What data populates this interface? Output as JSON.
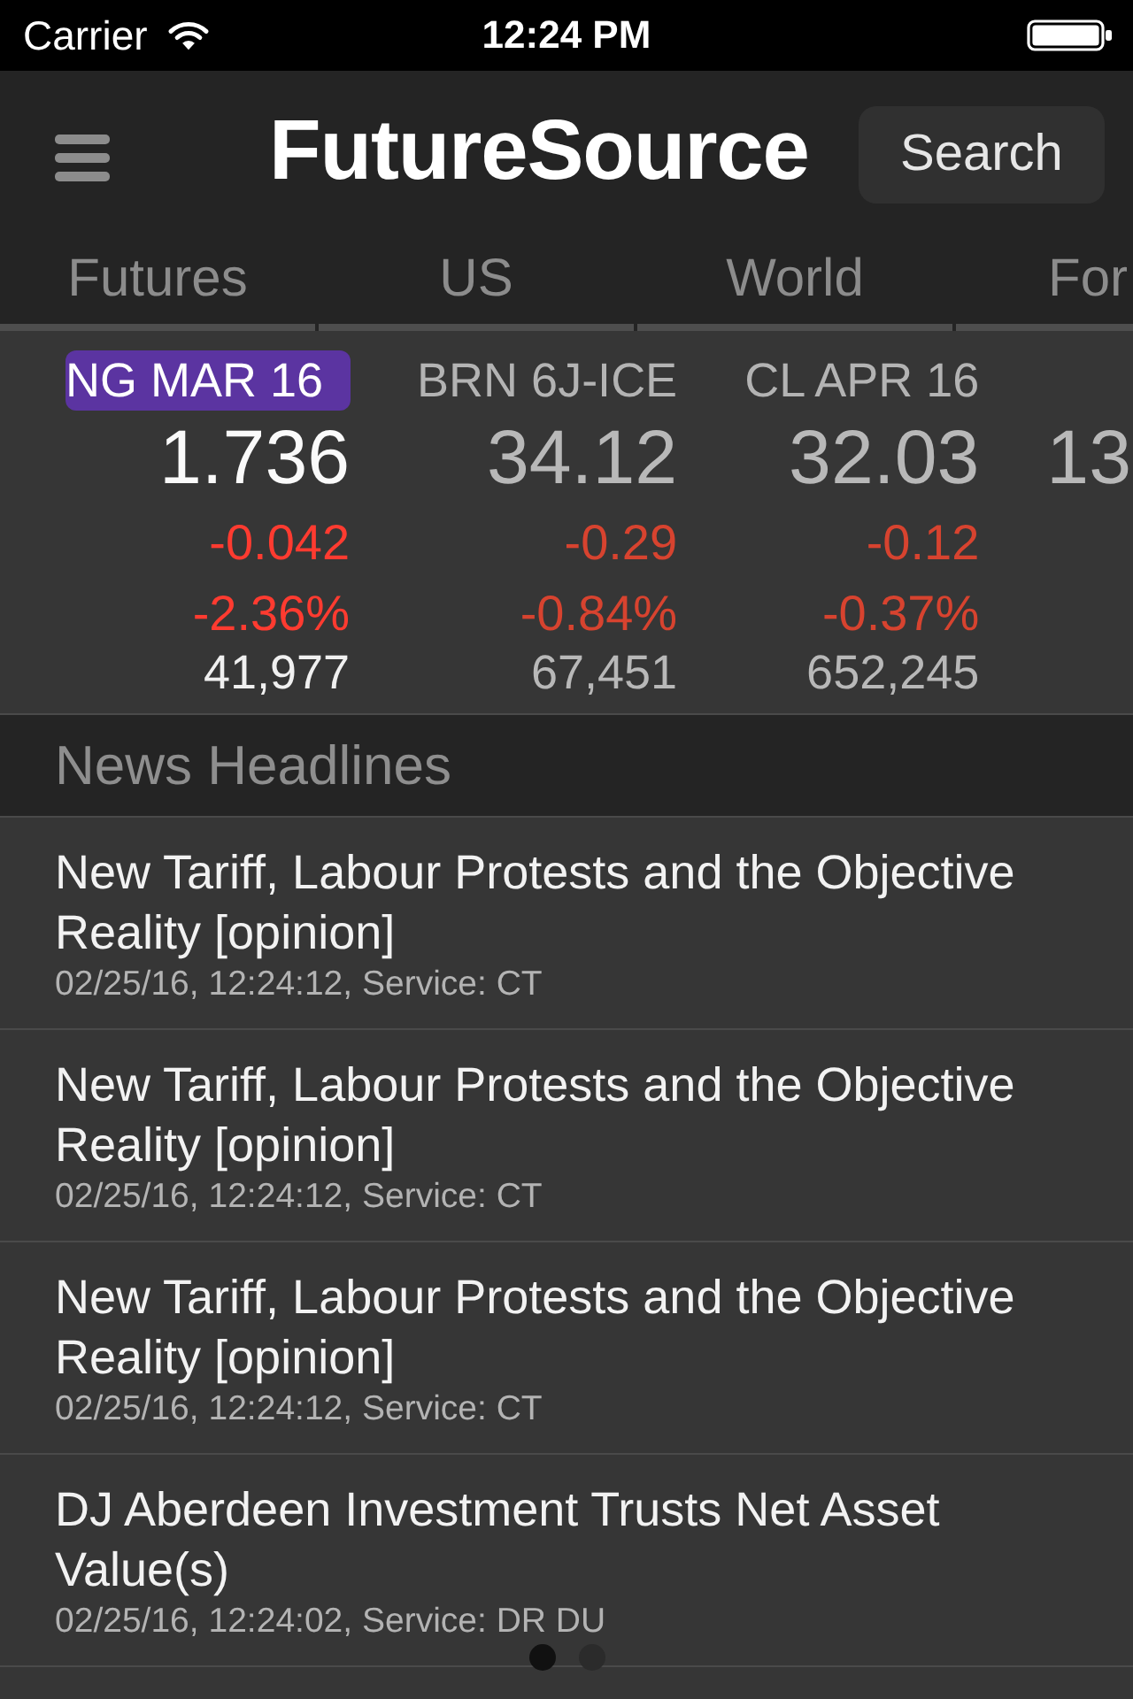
{
  "status_bar": {
    "carrier": "Carrier",
    "time": "12:24 PM"
  },
  "nav_bar": {
    "logo": "FutureSource",
    "search_button": "Search"
  },
  "tabs": [
    {
      "label": "Futures"
    },
    {
      "label": "US"
    },
    {
      "label": "World"
    },
    {
      "label": "For"
    }
  ],
  "quotes": [
    {
      "symbol": "NG MAR 16",
      "price": "1.736",
      "change": "-0.042",
      "percent_change": "-2.36%",
      "volume": "41,977",
      "falling": true,
      "selected": true
    },
    {
      "symbol": "BRN 6J-ICE",
      "price": "34.12",
      "change": "-0.29",
      "percent_change": "-0.84%",
      "volume": "67,451",
      "falling": true,
      "selected": false
    },
    {
      "symbol": "CL APR 16",
      "price": "32.03",
      "change": "-0.12",
      "percent_change": "-0.37%",
      "volume": "652,245",
      "falling": true,
      "selected": false
    },
    {
      "price": "13",
      "selected": false
    }
  ],
  "news": {
    "title": "News Headlines",
    "items": [
      {
        "headline": "New Tariff, Labour Protests and the Objective Reality [opinion]",
        "meta": "02/25/16, 12:24:12, Service: CT"
      },
      {
        "headline": "New Tariff, Labour Protests and the Objective Reality [opinion]",
        "meta": "02/25/16, 12:24:12, Service: CT"
      },
      {
        "headline": "New Tariff, Labour Protests and the Objective Reality [opinion]",
        "meta": "02/25/16, 12:24:12, Service: CT"
      },
      {
        "headline": "DJ Aberdeen Investment Trusts Net Asset Value(s)",
        "meta": "02/25/16, 12:24:02, Service: DR DU"
      }
    ]
  },
  "page_control": [
    {
      "selected": true
    },
    {
      "selected": false
    }
  ]
}
